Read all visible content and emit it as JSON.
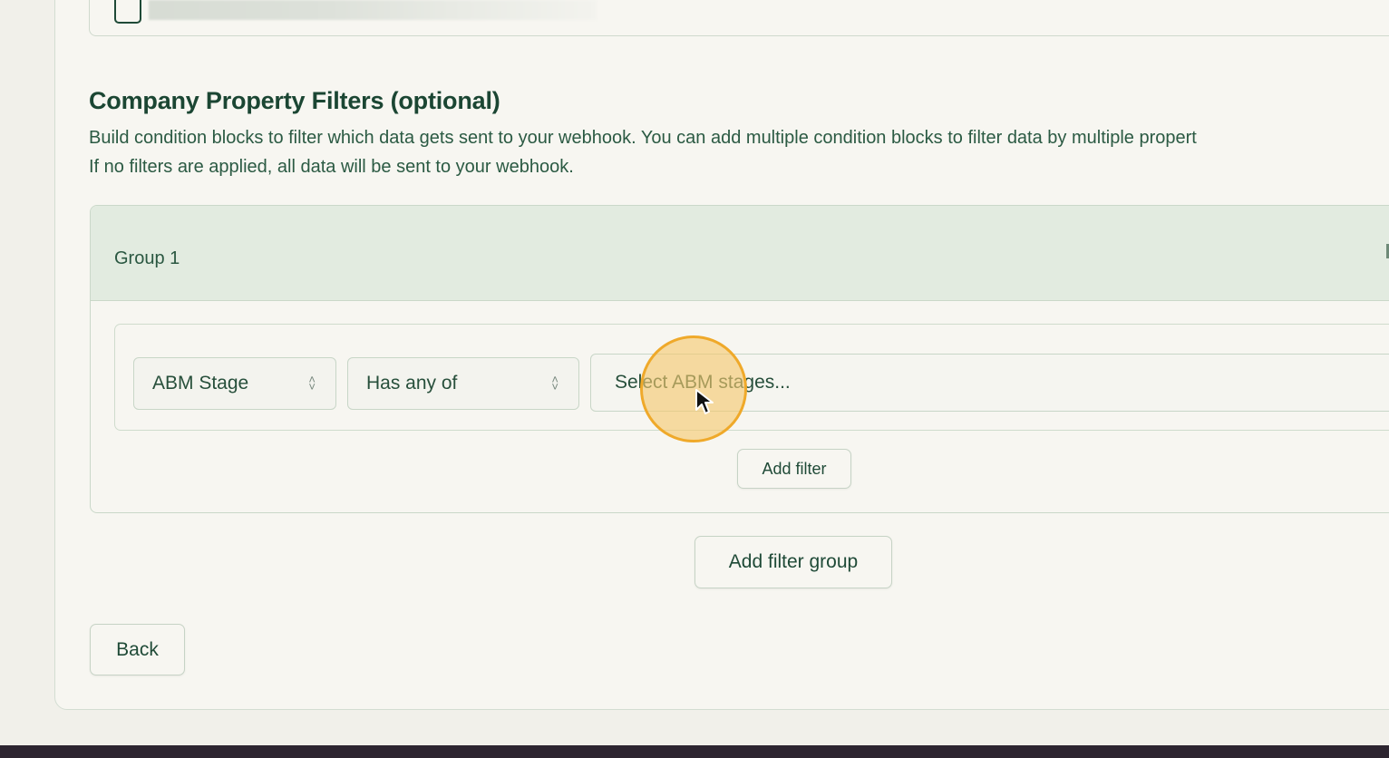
{
  "section": {
    "title": "Company Property Filters (optional)",
    "description_line1": "Build condition blocks to filter which data gets sent to your webhook. You can add multiple condition blocks to filter data by multiple propert",
    "description_line2": "If no filters are applied, all data will be sent to your webhook."
  },
  "group": {
    "title": "Group 1",
    "filter": {
      "property": "ABM Stage",
      "operator": "Has any of",
      "value_placeholder": "Select ABM stages..."
    },
    "add_filter_label": "Add filter"
  },
  "add_filter_group_label": "Add filter group",
  "back_label": "Back",
  "icons": {
    "updown": "chevron-updown-icon",
    "dropdown": "chevron-down-icon",
    "cursor": "mouse-pointer-icon"
  },
  "colors": {
    "accent": "#1f4a37",
    "group_header_bg": "#e2ebe0",
    "cursor_highlight": "#efa92a"
  }
}
